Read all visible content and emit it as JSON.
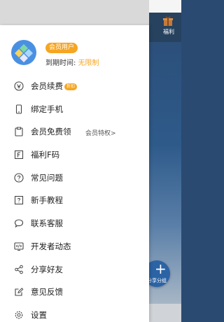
{
  "background": {
    "gift_label": "福利",
    "fab_label": "分享分组"
  },
  "profile": {
    "badge": "会员用户",
    "expire_label": "到期时间:",
    "expire_value": "无限制"
  },
  "menu": [
    {
      "label": "会员续费",
      "badge": "折扣",
      "icon": "vip-renew-icon"
    },
    {
      "label": "绑定手机",
      "icon": "phone-icon"
    },
    {
      "label": "会员免费领",
      "extra": "会员特权>",
      "icon": "clipboard-icon"
    },
    {
      "label": "福利F码",
      "icon": "f-code-icon"
    },
    {
      "label": "常见问题",
      "icon": "question-icon"
    },
    {
      "label": "新手教程",
      "icon": "tutorial-icon"
    },
    {
      "label": "联系客服",
      "icon": "chat-icon"
    },
    {
      "label": "开发者动态",
      "icon": "code-icon"
    },
    {
      "label": "分享好友",
      "icon": "share-icon"
    },
    {
      "label": "意见反馈",
      "icon": "edit-icon"
    },
    {
      "label": "设置",
      "icon": "gear-icon"
    }
  ],
  "colors": {
    "accent": "#f5a623",
    "avatar": "#4a90e2",
    "drawer_bg": "#ffffff"
  }
}
